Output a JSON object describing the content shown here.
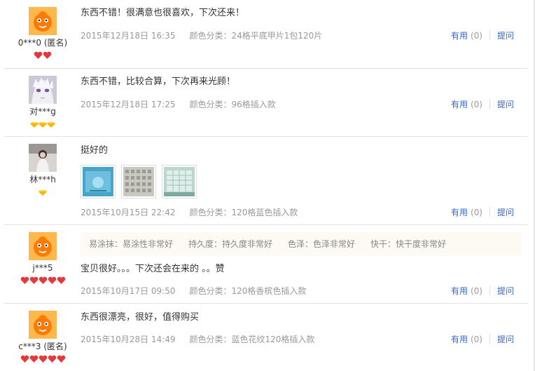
{
  "reviews": [
    {
      "user": "0***0 (匿名)",
      "avatar": "taobao-mascot-icon",
      "rank_icon": "red-heart-icon",
      "rank_count": 2,
      "text": "东西不错！很满意也很喜欢，下次还来！",
      "date": "2015年12月18日 16:35",
      "sku": "颜色分类：24格平底甲片1包120片",
      "useful_label": "有用",
      "useful_count": "(0)",
      "ask_label": "提问"
    },
    {
      "user": "对***g",
      "avatar": "anime-avatar",
      "rank_icon": "yellow-diamond-icon",
      "rank_count": 3,
      "text": "东西不错，比较合算，下次再来光顾！",
      "date": "2015年12月18日 17:25",
      "sku": "颜色分类：96格插入款",
      "useful_label": "有用",
      "useful_count": "(0)",
      "ask_label": "提问"
    },
    {
      "user": "林***h",
      "avatar": "photo-avatar",
      "rank_icon": "yellow-diamond-icon",
      "rank_count": 1,
      "text": "挺好的",
      "date": "2015年10月15日 22:42",
      "sku": "颜色分类：120格蓝色插入款",
      "useful_label": "有用",
      "useful_count": "(0)",
      "ask_label": "提问",
      "photos": [
        "blue-box-photo",
        "grid-box-photo",
        "grid-box-photo-2"
      ]
    },
    {
      "user": "j***5",
      "avatar": "taobao-mascot-icon",
      "rank_icon": "red-heart-icon",
      "rank_count": 5,
      "tags": [
        "易涂抹：易涂性非常好",
        "持久度：持久度非常好",
        "色泽：色泽非常好",
        "快干：快干度非常好"
      ],
      "text": "宝贝很好。。。下次还会在来的 。。赞",
      "date": "2015年10月17日 09:50",
      "sku": "颜色分类：120格香槟色插入款",
      "useful_label": "有用",
      "useful_count": "(0)",
      "ask_label": "提问"
    },
    {
      "user": "c***3 (匿名)",
      "avatar": "taobao-mascot-icon",
      "rank_icon": "red-heart-icon",
      "rank_count": 5,
      "text": "东西很漂亮，很好，值得购买",
      "date": "2015年10月28日 14:49",
      "sku": "颜色分类：蓝色花纹120格插入款",
      "useful_label": "有用",
      "useful_count": "(0)",
      "ask_label": "提问"
    }
  ],
  "colors": {
    "link": "#3366cc",
    "meta": "#999999",
    "heart": "#e4393c",
    "diamond": "#f5b800",
    "mascot": "#ff7a00"
  }
}
